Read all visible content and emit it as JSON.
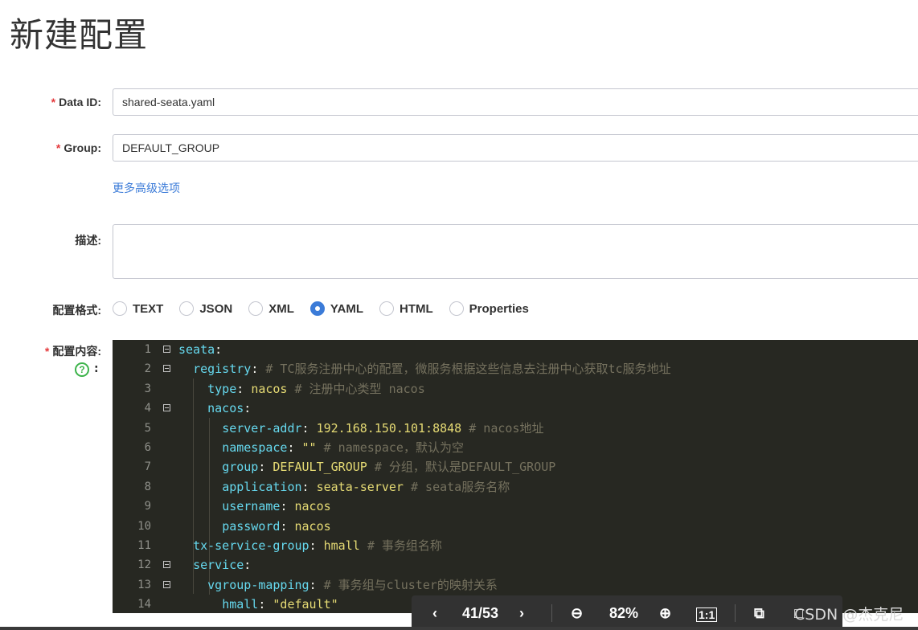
{
  "page": {
    "title": "新建配置"
  },
  "form": {
    "data_id": {
      "label": "Data ID:",
      "value": "shared-seata.yaml"
    },
    "group": {
      "label": "Group:",
      "value": "DEFAULT_GROUP"
    },
    "advanced_link": "更多高级选项",
    "description": {
      "label": "描述:",
      "value": ""
    },
    "format": {
      "label": "配置格式:",
      "options": [
        "TEXT",
        "JSON",
        "XML",
        "YAML",
        "HTML",
        "Properties"
      ],
      "selected": "YAML"
    },
    "content": {
      "label": "配置内容:",
      "help_colon": ":"
    },
    "required_mark": "*"
  },
  "editor": {
    "lines": [
      {
        "num": "1",
        "indent": "",
        "key": "seata",
        "sep": ":",
        "value": "",
        "comment": "",
        "fold": true
      },
      {
        "num": "2",
        "indent": "  ",
        "key": "registry",
        "sep": ":",
        "value": "",
        "comment": "# TC服务注册中心的配置，微服务根据这些信息去注册中心获取tc服务地址",
        "fold": true
      },
      {
        "num": "3",
        "indent": "    ",
        "key": "type",
        "sep": ":",
        "value": "nacos",
        "comment": "# 注册中心类型 nacos",
        "fold": false
      },
      {
        "num": "4",
        "indent": "    ",
        "key": "nacos",
        "sep": ":",
        "value": "",
        "comment": "",
        "fold": true
      },
      {
        "num": "5",
        "indent": "      ",
        "key": "server-addr",
        "sep": ":",
        "value": "192.168.150.101:8848",
        "comment": "# nacos地址",
        "fold": false
      },
      {
        "num": "6",
        "indent": "      ",
        "key": "namespace",
        "sep": ":",
        "value": "\"\"",
        "comment": "# namespace，默认为空",
        "fold": false
      },
      {
        "num": "7",
        "indent": "      ",
        "key": "group",
        "sep": ":",
        "value": "DEFAULT_GROUP",
        "comment": "# 分组，默认是DEFAULT_GROUP",
        "fold": false
      },
      {
        "num": "8",
        "indent": "      ",
        "key": "application",
        "sep": ":",
        "value": "seata-server",
        "comment": "# seata服务名称",
        "fold": false
      },
      {
        "num": "9",
        "indent": "      ",
        "key": "username",
        "sep": ":",
        "value": "nacos",
        "comment": "",
        "fold": false
      },
      {
        "num": "10",
        "indent": "      ",
        "key": "password",
        "sep": ":",
        "value": "nacos",
        "comment": "",
        "fold": false
      },
      {
        "num": "11",
        "indent": "  ",
        "key": "tx-service-group",
        "sep": ":",
        "value": "hmall",
        "comment": "# 事务组名称",
        "fold": false
      },
      {
        "num": "12",
        "indent": "  ",
        "key": "service",
        "sep": ":",
        "value": "",
        "comment": "",
        "fold": true
      },
      {
        "num": "13",
        "indent": "    ",
        "key": "vgroup-mapping",
        "sep": ":",
        "value": "",
        "comment": "# 事务组与cluster的映射关系",
        "fold": true
      },
      {
        "num": "14",
        "indent": "      ",
        "key": "hmall",
        "sep": ":",
        "value": "\"default\"",
        "comment": "",
        "fold": false
      }
    ]
  },
  "pdf_toolbar": {
    "page": "41/53",
    "zoom": "82%"
  },
  "watermark": "CSDN @杰克尼",
  "colors": {
    "accent": "#3b7bd8",
    "required": "#e4393c",
    "editor_bg": "#272822"
  }
}
